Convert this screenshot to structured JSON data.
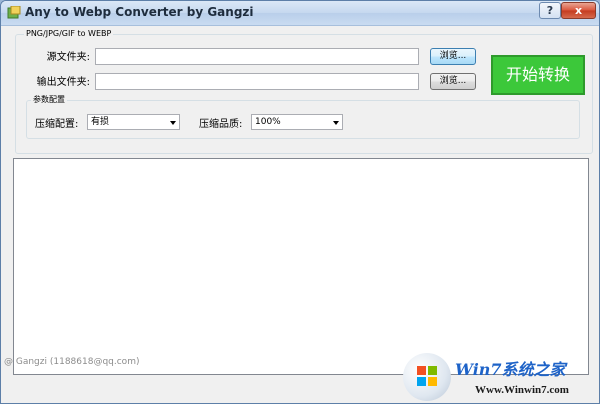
{
  "window": {
    "title": "Any to Webp Converter by Gangzi",
    "help_label": "?",
    "close_label": "x"
  },
  "main_group": {
    "label": "PNG/JPG/GIF to WEBP",
    "source_label": "源文件夹:",
    "source_value": "",
    "output_label": "输出文件夹:",
    "output_value": "",
    "browse_label": "浏览...",
    "start_label": "开始转换"
  },
  "params_group": {
    "label": "参数配置",
    "compress_mode_label": "压缩配置:",
    "compress_mode_value": "有损",
    "quality_label": "压缩品质:",
    "quality_value": "100%"
  },
  "log": {
    "content": ""
  },
  "status": {
    "text": "@ Gangzi (1188618@qq.com)"
  },
  "watermark": {
    "brand": "Win7系统之家",
    "url": "Www.Winwin7.com"
  },
  "colors": {
    "start_button": "#3cc83a",
    "titlebar": "#c5d8ef",
    "close_button": "#d9543a"
  }
}
